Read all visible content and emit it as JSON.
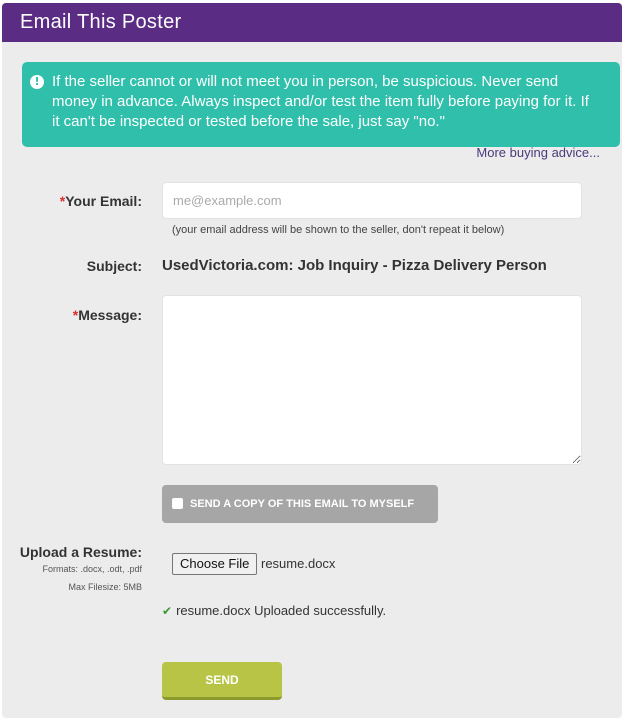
{
  "header": {
    "title": "Email This Poster"
  },
  "alert": {
    "text": "If the seller cannot or will not meet you in person, be suspicious. Never send money in advance. Always inspect and/or test the item fully before paying for it. If it can't be inspected or tested before the sale, just say \"no.\"",
    "icon": "exclamation-circle-icon"
  },
  "more_link": "More buying advice...",
  "email": {
    "required_mark": "*",
    "label": "Your Email:",
    "placeholder": "me@example.com",
    "value": "",
    "hint": "(your email address will be shown to the seller, don't repeat it below)"
  },
  "subject": {
    "label": "Subject:",
    "value": "UsedVictoria.com: Job Inquiry - Pizza Delivery Person"
  },
  "message": {
    "required_mark": "*",
    "label": "Message:",
    "value": ""
  },
  "copy": {
    "label": "SEND A COPY OF THIS EMAIL TO MYSELF",
    "checked": false
  },
  "upload": {
    "label": "Upload a Resume:",
    "formats": "Formats: .docx, .odt, .pdf",
    "maxsize": "Max Filesize: 5MB",
    "button": "Choose File",
    "filename": "resume.docx",
    "success": "resume.docx Uploaded successfully.",
    "success_icon": "checkmark-icon"
  },
  "send": {
    "label": "SEND"
  },
  "colors": {
    "header": "#5b2c83",
    "alert": "#2fbfab",
    "send": "#b7c445",
    "required": "#d9302c",
    "success": "#3a9a2e"
  }
}
